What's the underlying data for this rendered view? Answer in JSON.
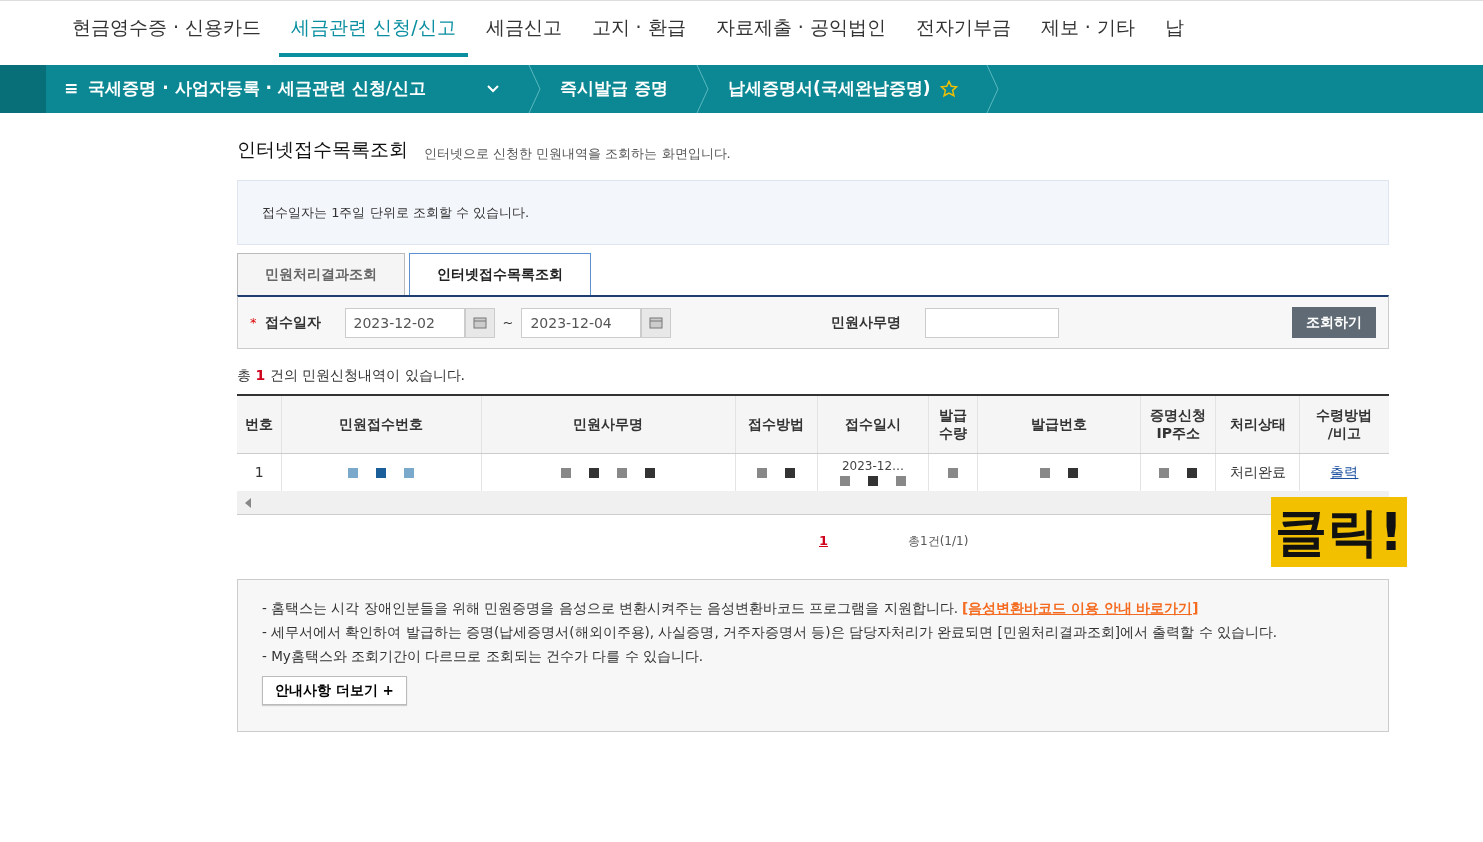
{
  "top_menu": [
    {
      "label": "현금영수증 · 신용카드",
      "selected": false
    },
    {
      "label": "세금관련 신청/신고",
      "selected": true
    },
    {
      "label": "세금신고",
      "selected": false
    },
    {
      "label": "고지 · 환급",
      "selected": false
    },
    {
      "label": "자료제출 · 공익법인",
      "selected": false
    },
    {
      "label": "전자기부금",
      "selected": false
    },
    {
      "label": "제보 · 기타",
      "selected": false
    },
    {
      "label": "납",
      "selected": false
    }
  ],
  "breadcrumb": {
    "menu_icon": "≡",
    "items": [
      "국세증명 · 사업자등록 · 세금관련 신청/신고",
      "즉시발급 증명",
      "납세증명서(국세완납증명)"
    ],
    "starred": false
  },
  "page": {
    "title": "인터넷접수목록조회",
    "subtitle": "인터넷으로 신청한 민원내역을 조회하는 화면입니다."
  },
  "notice": "접수일자는 1주일 단위로 조회할 수 있습니다.",
  "tabs": [
    {
      "label": "민원처리결과조회",
      "selected": false
    },
    {
      "label": "인터넷접수목록조회",
      "selected": true
    }
  ],
  "search": {
    "required_mark": "*",
    "date_label": "접수일자",
    "date_from": "2023-12-02",
    "separator": "~",
    "date_to": "2023-12-04",
    "office_label": "민원사무명",
    "button": "조회하기"
  },
  "summary": {
    "prefix": "총",
    "count": "1",
    "suffix": "건의 민원신청내역이 있습니다."
  },
  "table": {
    "columns": [
      "번호",
      "민원접수번호",
      "민원사무명",
      "접수방법",
      "접수일시",
      "발급\n수량",
      "발급번호",
      "증명신청\nIP주소",
      "처리상태",
      "수령방법\n/비고"
    ],
    "rows": [
      [
        {
          "text": "1"
        },
        {
          "redacted": true
        },
        {
          "redacted": true
        },
        {
          "redacted": true
        },
        {
          "text": "2023-12…",
          "redacted": true
        },
        {
          "redacted": true
        },
        {
          "redacted": true
        },
        {
          "redacted": true
        },
        {
          "text": "처리완료"
        },
        {
          "text": "출력",
          "kind": "link"
        }
      ]
    ]
  },
  "pagination": {
    "pages": [
      {
        "label": "1",
        "selected": true
      }
    ],
    "total": "총1건(1/1)"
  },
  "callout": "클릭!",
  "info": {
    "lines": [
      {
        "text": "- 홈택스는 시각 장애인분들을 위해 민원증명을 음성으로 변환시켜주는 음성변환바코드 프로그램을 지원합니다.",
        "link": "[음성변환바코드 이용 안내 바로가기]"
      },
      {
        "text": "- 세무서에서 확인하여 발급하는 증명(납세증명서(해외이주용), 사실증명, 거주자증명서 등)은 담당자처리가 완료되면 [민원처리결과조회]에서 출력할 수 있습니다."
      },
      {
        "text": "- My홈택스와 조회기간이 다르므로 조회되는 건수가 다를 수 있습니다."
      }
    ],
    "more_button": "안내사항 더보기 +"
  }
}
